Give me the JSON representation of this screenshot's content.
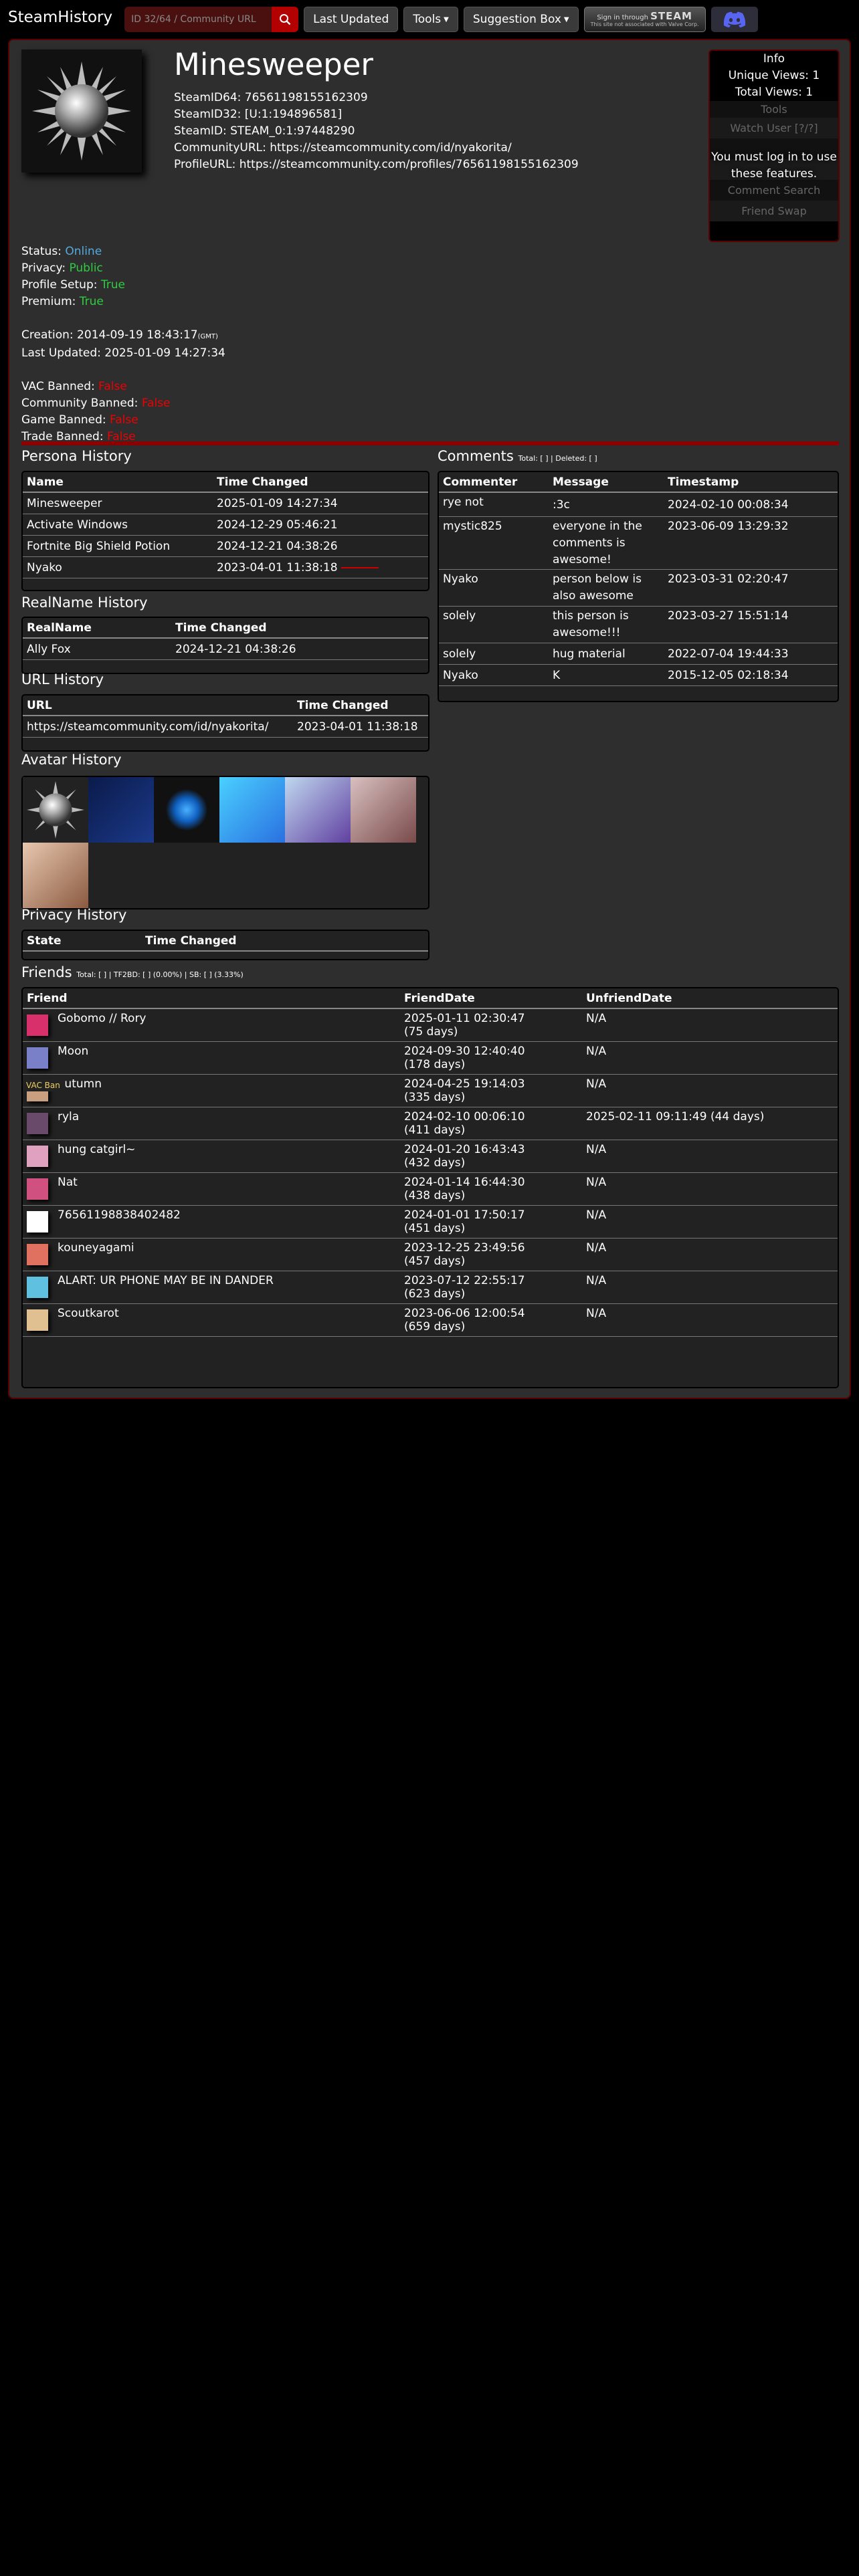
{
  "nav": {
    "brand": "SteamHistory",
    "search_placeholder": "ID 32/64 / Community URL",
    "last_updated": "Last Updated",
    "tools": "Tools",
    "suggestion_box": "Suggestion Box",
    "steam_signin_top": "Sign in through",
    "steam_signin_brand": "STEAM",
    "steam_signin_note": "This site not associated with Valve Corp."
  },
  "profile": {
    "name": "Minesweeper",
    "steamid64": "SteamID64: 76561198155162309",
    "steamid32": "SteamID32: [U:1:194896581]",
    "steamid": "SteamID: STEAM_0:1:97448290",
    "community_url": "CommunityURL: https://steamcommunity.com/id/nyakorita/",
    "profile_url_label": "ProfileURL: ",
    "profile_url": "https://steamcommunity.com/profiles/76561198155162309"
  },
  "info": {
    "header": "Info",
    "unique_views": "Unique Views: 1",
    "total_views": "Total Views: 1",
    "tools": "Tools",
    "watch_user": "Watch User [?/?]",
    "login_notice": "You must log in to use these features.",
    "comment_search": "Comment Search",
    "friend_swap": "Friend Swap"
  },
  "status": {
    "status_label": "Status: ",
    "status_value": "Online",
    "privacy_label": "Privacy: ",
    "privacy_value": "Public",
    "setup_label": "Profile Setup: ",
    "setup_value": "True",
    "premium_label": "Premium: ",
    "premium_value": "True",
    "creation": "Creation: 2014-09-19 18:43:17",
    "creation_tz": "(GMT)",
    "last_updated": "Last Updated: 2025-01-09 14:27:34",
    "vac_label": "VAC Banned: ",
    "vac_value": "False",
    "community_label": "Community Banned: ",
    "community_value": "False",
    "game_label": "Game Banned: ",
    "game_value": "False",
    "trade_label": "Trade Banned: ",
    "trade_value": "False"
  },
  "persona": {
    "title": "Persona History",
    "col_name": "Name",
    "col_time": "Time Changed",
    "rows": [
      {
        "name": "Minesweeper",
        "time": "2025-01-09 14:27:34"
      },
      {
        "name": "Activate Windows",
        "time": "2024-12-29 05:46:21"
      },
      {
        "name": "Fortnite Big Shield Potion",
        "time": "2024-12-21 04:38:26"
      },
      {
        "name": "Nyako",
        "time": "2023-04-01 11:38:18"
      }
    ]
  },
  "realname": {
    "title": "RealName History",
    "col_name": "RealName",
    "col_time": "Time Changed",
    "rows": [
      {
        "name": "Ally Fox",
        "time": "2024-12-21 04:38:26"
      }
    ]
  },
  "url_history": {
    "title": "URL History",
    "col_url": "URL",
    "col_time": "Time Changed",
    "rows": [
      {
        "url": "https://steamcommunity.com/id/nyakorita/",
        "time": "2023-04-01 11:38:18"
      }
    ]
  },
  "avatar_history": {
    "title": "Avatar History"
  },
  "privacy": {
    "title": "Privacy History",
    "col_state": "State",
    "col_time": "Time Changed"
  },
  "comments": {
    "title": "Comments",
    "summary_total": "Total: [ ]",
    "summary_deleted": "| Deleted: [ ]",
    "col_commenter": "Commenter",
    "col_message": "Message",
    "col_time": "Timestamp",
    "rows": [
      {
        "commenter": "rye not",
        "message": ":3c",
        "time": "2024-02-10 00:08:34"
      },
      {
        "commenter": "mystic825",
        "message": "everyone in the comments is awesome!",
        "time": "2023-06-09 13:29:32"
      },
      {
        "commenter": "Nyako",
        "message": "person below is also awesome",
        "time": "2023-03-31 02:20:47"
      },
      {
        "commenter": "solely",
        "message": "this person is awesome!!!",
        "time": "2023-03-27 15:51:14"
      },
      {
        "commenter": "solely",
        "message": "hug material",
        "time": "2022-07-04 19:44:33"
      },
      {
        "commenter": "Nyako",
        "message": "K",
        "time": "2015-12-05 02:18:34"
      }
    ]
  },
  "friends": {
    "title": "Friends",
    "summary": "Total: [ ] | TF2BD: [ ] (0.00%) | SB: [ ] (3.33%)",
    "col_friend": "Friend",
    "col_date": "FriendDate",
    "col_unfriend": "UnfriendDate",
    "vac_ban_badge": "VAC Ban",
    "rows": [
      {
        "name": "Gobomo // Rory",
        "date": "2025-01-11 02:30:47",
        "days": "(75 days)",
        "unfriend": "N/A",
        "color": "#d8306a"
      },
      {
        "name": "Moon",
        "date": "2024-09-30 12:40:40",
        "days": "(178 days)",
        "unfriend": "N/A",
        "color": "#7a80c8"
      },
      {
        "name": "autumn",
        "date": "2024-04-25 19:14:03",
        "days": "(335 days)",
        "unfriend": "N/A",
        "color": "#c8a080"
      },
      {
        "name": "ryla",
        "date": "2024-02-10 00:06:10",
        "days": "(411 days)",
        "unfriend": "2025-02-11 09:11:49 (44 days)",
        "color": "#6a4a6a"
      },
      {
        "name": "hung catgirl~",
        "date": "2024-01-20 16:43:43",
        "days": "(432 days)",
        "unfriend": "N/A",
        "color": "#e0a0c0"
      },
      {
        "name": "Nat",
        "date": "2024-01-14 16:44:30",
        "days": "(438 days)",
        "unfriend": "N/A",
        "color": "#d05080"
      },
      {
        "name": "76561198838402482",
        "date": "2024-01-01 17:50:17",
        "days": "(451 days)",
        "unfriend": "N/A",
        "color": "#ffffff"
      },
      {
        "name": "kouneyagami",
        "date": "2023-12-25 23:49:56",
        "days": "(457 days)",
        "unfriend": "N/A",
        "color": "#e07060"
      },
      {
        "name": "ALART: UR PHONE MAY BE IN DANDER",
        "date": "2023-07-12 22:55:17",
        "days": "(623 days)",
        "unfriend": "N/A",
        "color": "#60c0e0"
      },
      {
        "name": "Scoutkarot",
        "date": "2023-06-06 12:00:54",
        "days": "(659 days)",
        "unfriend": "N/A",
        "color": "#e0c090"
      }
    ]
  },
  "colors": {
    "accent_red": "#b30000",
    "border_red": "#5a0000",
    "online_green": "#2ecc40"
  },
  "icons": {
    "search": "search-icon",
    "discord": "discord-icon",
    "avatar": "spiky-mine-icon"
  }
}
